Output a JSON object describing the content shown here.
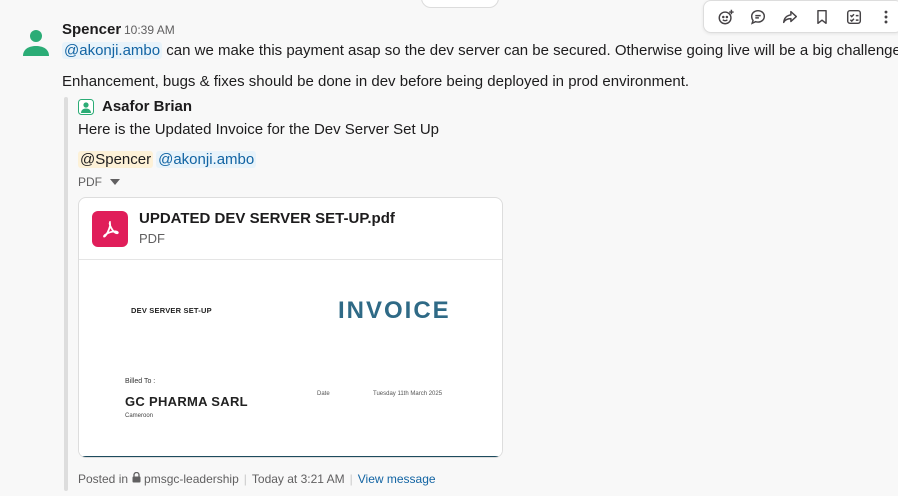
{
  "message": {
    "sender": "Spencer",
    "time": "10:39 AM",
    "mention1": "@akonji.ambo",
    "text1": " can we make this payment asap so the dev server can be secured. Otherwise going live will be a big challenge.",
    "text2": "Enhancement, bugs & fixes should be done in dev before being deployed in prod environment."
  },
  "quote": {
    "author": "Asafor Brian",
    "text": "Here is the Updated Invoice for the Dev Server Set Up",
    "mention_a": "@Spencer",
    "mention_b": "@akonji.ambo",
    "attachment_toggle": "PDF"
  },
  "file": {
    "name": "UPDATED DEV SERVER SET-UP.pdf",
    "type": "PDF",
    "preview": {
      "setup_title": "DEV SERVER SET-UP",
      "heading": "INVOICE",
      "billed_to": "Billed To :",
      "company": "GC PHARMA SARL",
      "country": "Cameroon",
      "date_label": "Date",
      "date_value": "Tuesday 11th March 2025"
    }
  },
  "footer": {
    "posted_in": "Posted in",
    "channel": "pmsgc-leadership",
    "when": "Today at 3:21 AM",
    "view": "View message"
  },
  "toolbar": {
    "icons": [
      "add-reaction-icon",
      "reply-thread-icon",
      "forward-icon",
      "bookmark-icon",
      "add-list-icon",
      "more-icon"
    ]
  },
  "colors": {
    "mention_bg": "#e8f3fa",
    "mention_text": "#1264a3",
    "pdf_red": "#e01e5a",
    "invoice_blue": "#2f6a86",
    "avatar_green": "#2bac76"
  }
}
